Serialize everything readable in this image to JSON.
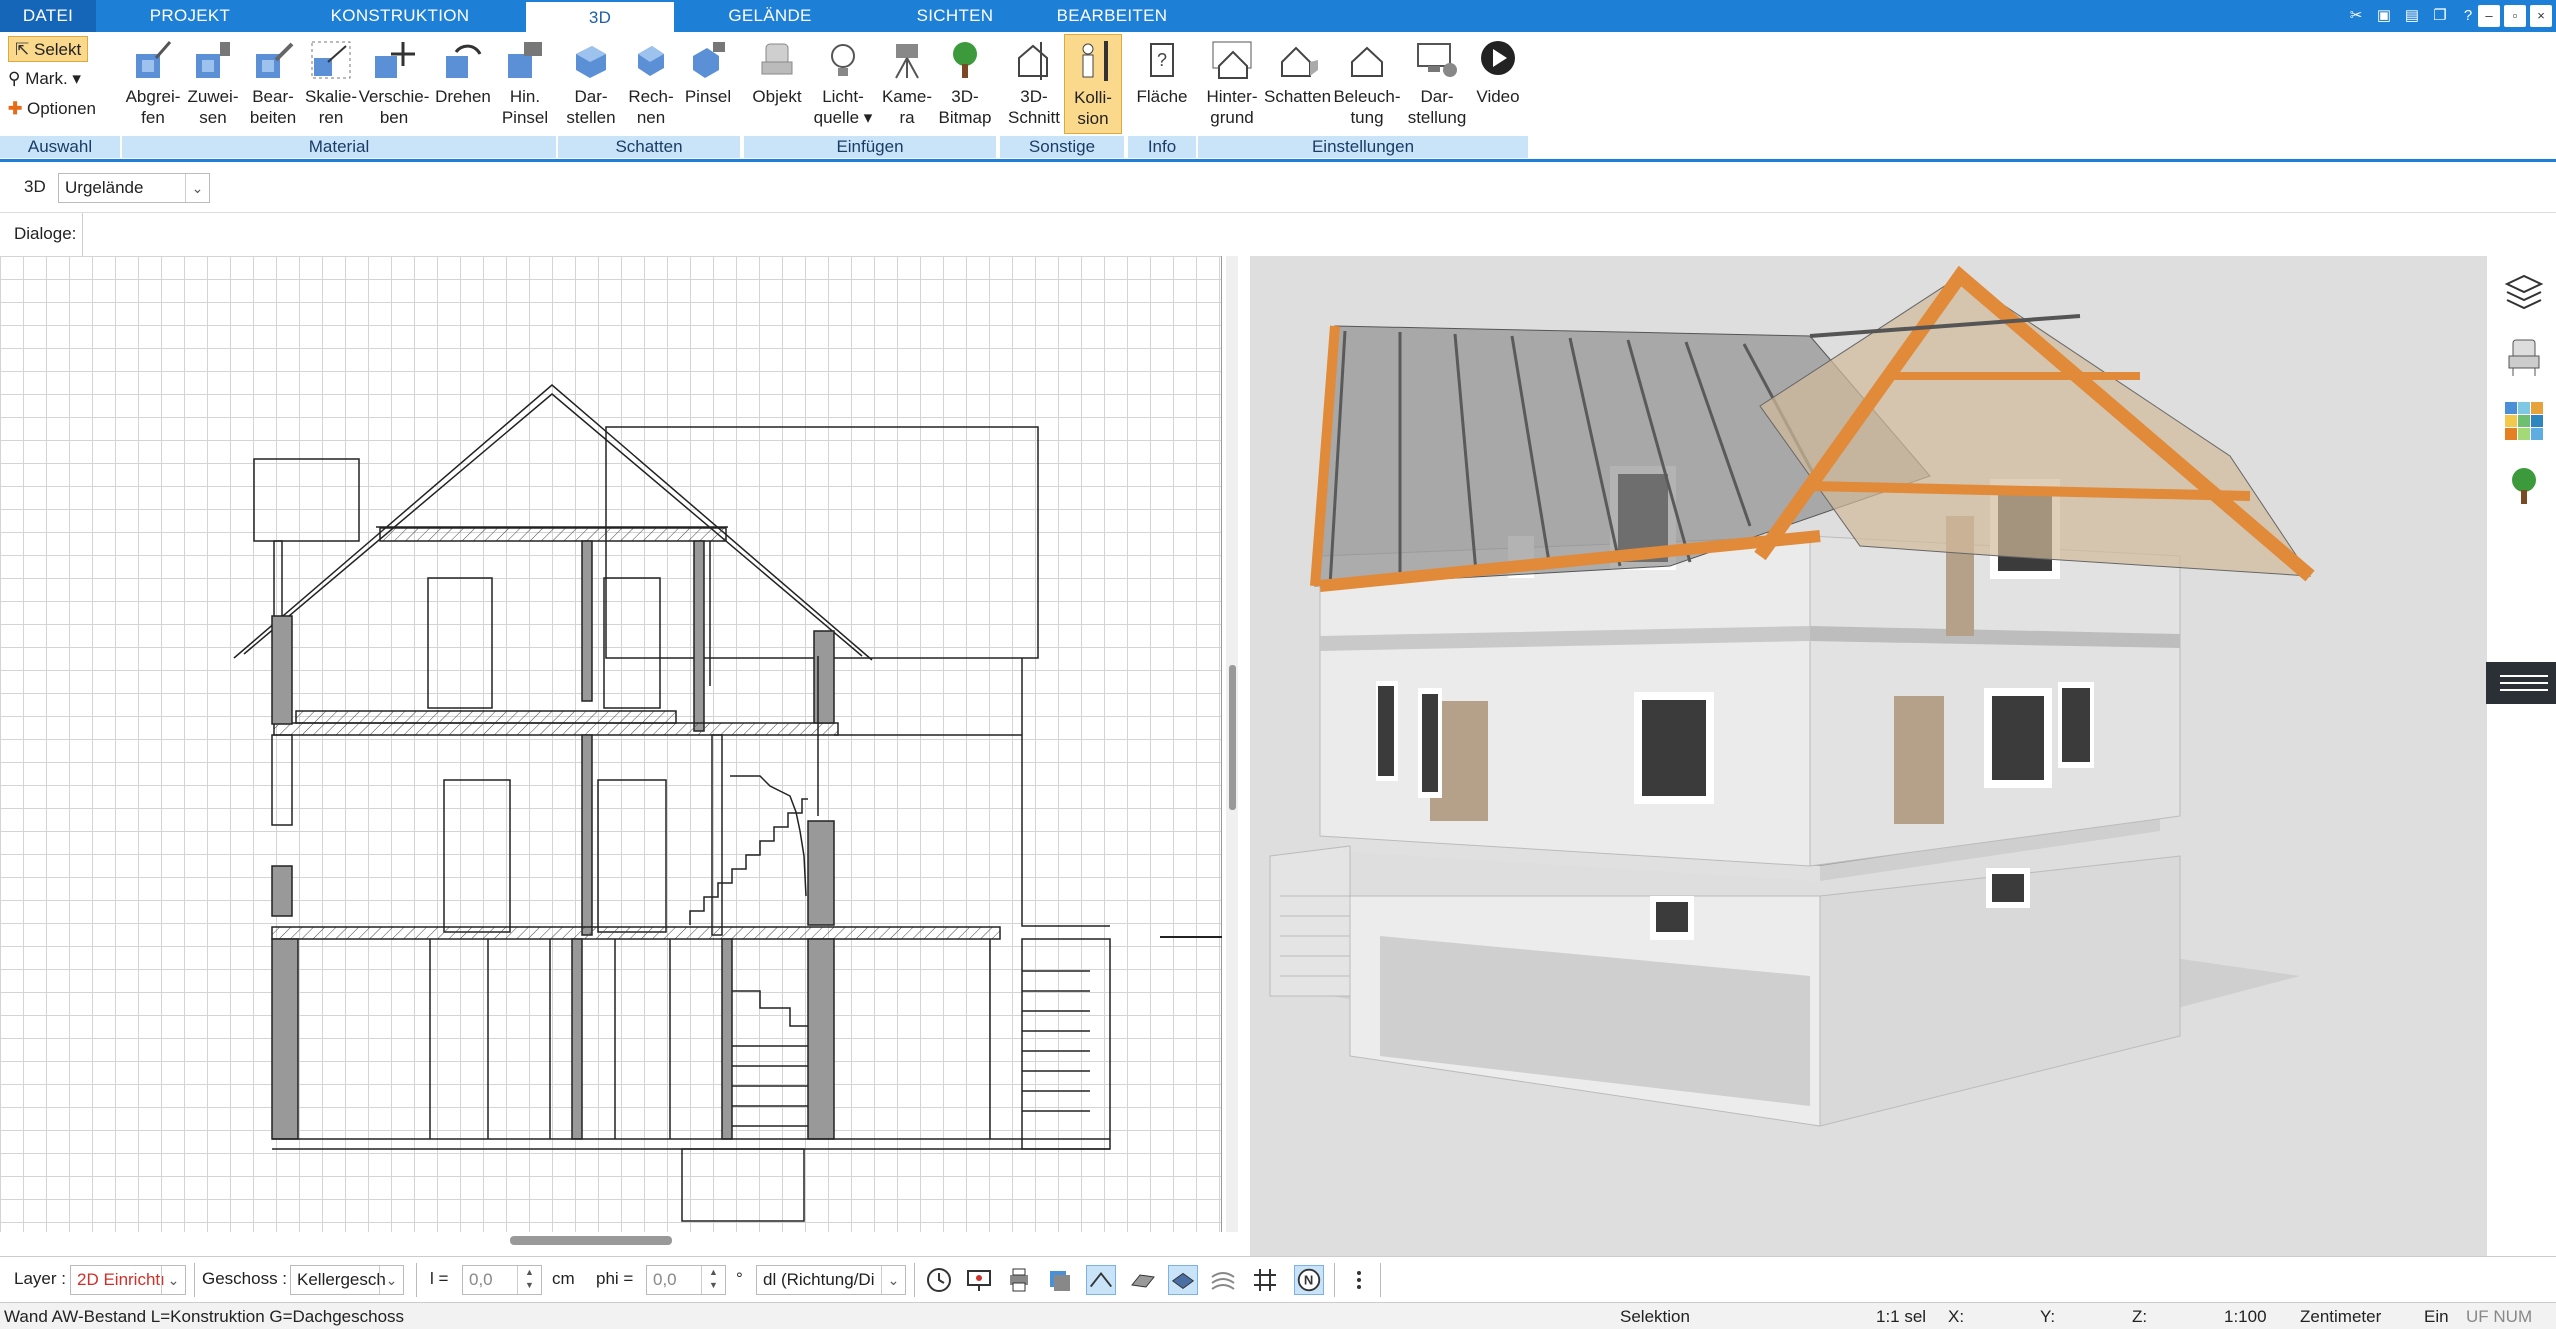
{
  "tabs": [
    {
      "label": "DATEI"
    },
    {
      "label": "PROJEKT"
    },
    {
      "label": "KONSTRUKTION"
    },
    {
      "label": "3D"
    },
    {
      "label": "GELÄNDE"
    },
    {
      "label": "SICHTEN"
    },
    {
      "label": "BEARBEITEN"
    }
  ],
  "ribbon": {
    "selection": {
      "selekt": "Selekt",
      "mark": "Mark.",
      "optionen": "Optionen",
      "group": "Auswahl"
    },
    "material": {
      "group": "Material",
      "buttons": [
        {
          "l1": "Abgrei-",
          "l2": "fen"
        },
        {
          "l1": "Zuwei-",
          "l2": "sen"
        },
        {
          "l1": "Bear-",
          "l2": "beiten"
        },
        {
          "l1": "Skalie-",
          "l2": "ren"
        },
        {
          "l1": "Verschie-",
          "l2": "ben"
        },
        {
          "l1": "Drehen",
          "l2": ""
        },
        {
          "l1": "Hin.",
          "l2": "Pinsel"
        }
      ]
    },
    "schatten": {
      "group": "Schatten",
      "buttons": [
        {
          "l1": "Dar-",
          "l2": "stellen"
        },
        {
          "l1": "Rech-",
          "l2": "nen"
        },
        {
          "l1": "Pinsel",
          "l2": ""
        }
      ]
    },
    "einfuegen": {
      "group": "Einfügen",
      "buttons": [
        {
          "l1": "Objekt",
          "l2": ""
        },
        {
          "l1": "Licht-",
          "l2": "quelle ▾"
        },
        {
          "l1": "Kame-",
          "l2": "ra"
        },
        {
          "l1": "3D-",
          "l2": "Bitmap"
        }
      ]
    },
    "sonstige": {
      "group": "Sonstige",
      "buttons": [
        {
          "l1": "3D-",
          "l2": "Schnitt"
        },
        {
          "l1": "Kolli-",
          "l2": "sion"
        }
      ]
    },
    "info": {
      "group": "Info",
      "buttons": [
        {
          "l1": "Fläche",
          "l2": ""
        }
      ]
    },
    "einstellungen": {
      "group": "Einstellungen",
      "buttons": [
        {
          "l1": "Hinter-",
          "l2": "grund"
        },
        {
          "l1": "Schatten",
          "l2": ""
        },
        {
          "l1": "Beleuch-",
          "l2": "tung"
        },
        {
          "l1": "Dar-",
          "l2": "stellung"
        },
        {
          "l1": "Video",
          "l2": ""
        }
      ]
    }
  },
  "view_row": {
    "label": "3D",
    "combo_value": "Urgelände"
  },
  "dialoge_label": "Dialoge:",
  "bottom": {
    "layer_label": "Layer :",
    "layer_value": "2D Einrichtı",
    "geschoss_label": "Geschoss :",
    "geschoss_value": "Kellergesch",
    "l_label": "l =",
    "l_value": "0,0",
    "l_unit": "cm",
    "phi_label": "phi =",
    "phi_value": "0,0",
    "phi_unit": "°",
    "dl_value": "dl (Richtung/Di"
  },
  "status": {
    "left": "Wand AW-Bestand L=Konstruktion G=Dachgeschoss",
    "selektion": "Selektion",
    "sel": "1:1 sel",
    "x": "X:",
    "y": "Y:",
    "z": "Z:",
    "scale": "1:100",
    "unit": "Zentimeter",
    "ein": "Ein",
    "flags": "UF NUM RF"
  },
  "colors": {
    "accent": "#1e7fd6",
    "active_button": "#fbd98c",
    "group_label_bg": "#c9e3f9",
    "roof_timber": "#e08a3a"
  }
}
